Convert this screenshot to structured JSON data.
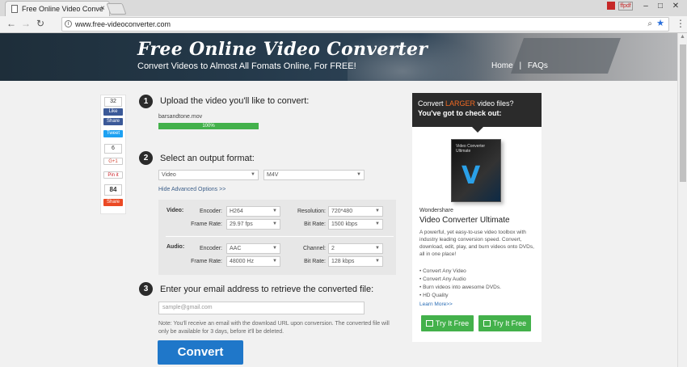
{
  "browser": {
    "tab_title": "Free Online Video Conve",
    "tab_close": "×",
    "window_controls": {
      "minimize": "–",
      "maximize": "□",
      "close": "✕"
    },
    "profile_badge": "ffpdf",
    "back": "←",
    "forward": "→",
    "reload": "↻",
    "url": "www.free-videoconverter.com",
    "menu": "⋮"
  },
  "hero": {
    "title": "Free Online Video Converter",
    "subtitle": "Convert Videos to Almost All Fomats Online, For FREE!",
    "nav": {
      "home": "Home",
      "sep": "|",
      "faqs": "FAQs"
    }
  },
  "social": {
    "fb_count": "32",
    "fb_like": "Like",
    "fb_share": "Share",
    "tweet": "Tweet",
    "gplus_count": "6",
    "gplus": "G+1",
    "pinit": "Pin it",
    "su_count": "84",
    "su_share": "Share"
  },
  "step1": {
    "number": "1",
    "title": "Upload the video you'll like to convert:",
    "file_name": "barsandtone.mov",
    "progress_text": "100%",
    "progress": 1.0
  },
  "step2": {
    "number": "2",
    "title": "Select an output format:",
    "format_type": "Video",
    "format": "M4V",
    "advanced_toggle": "Hide Advanced Options >>",
    "video": {
      "section": "Video:",
      "encoder_label": "Encoder:",
      "encoder": "H264",
      "resolution_label": "Resolution:",
      "resolution": "720*480",
      "framerate_label": "Frame Rate:",
      "framerate": "29.97 fps",
      "bitrate_label": "Bit Rate:",
      "bitrate": "1500 kbps"
    },
    "audio": {
      "section": "Audio:",
      "encoder_label": "Encoder:",
      "encoder": "AAC",
      "channel_label": "Channel:",
      "channel": "2",
      "framerate_label": "Frame Rate:",
      "framerate": "48000 Hz",
      "bitrate_label": "Bit Rate:",
      "bitrate": "128 kbps"
    }
  },
  "step3": {
    "number": "3",
    "title": "Enter your email address to retrieve the converted file:",
    "email_placeholder": "sample@gmail.com",
    "note": "Note: You'll receive an email with the download URL upon conversion. The converted file will only be available for 3 days, before it'll be deleted.",
    "convert_button": "Convert"
  },
  "sidebar": {
    "head_pre": "Convert ",
    "head_highlight": "LARGER",
    "head_post": " video files?",
    "head_line2": "You've got to check out:",
    "box_title": "Video Converter Ultimate",
    "brand": "Wondershare",
    "product": "Video Converter Ultimate",
    "description": "A powerful, yet easy-to-use video toolbox with industry leading conversion speed. Convert, download, edit, play, and burn videos onto DVDs, all in one place!",
    "features": [
      "• Convert Any Video",
      "• Convert Any Audio",
      "• Burn videos into awesome DVDs.",
      "• HD Quality"
    ],
    "learn_more": "Learn More>>",
    "try_win": "Try It Free",
    "try_mac": "Try It Free"
  },
  "colors": {
    "accent_orange": "#f26a22",
    "convert_blue": "#1f77c9",
    "green": "#43b14b"
  }
}
